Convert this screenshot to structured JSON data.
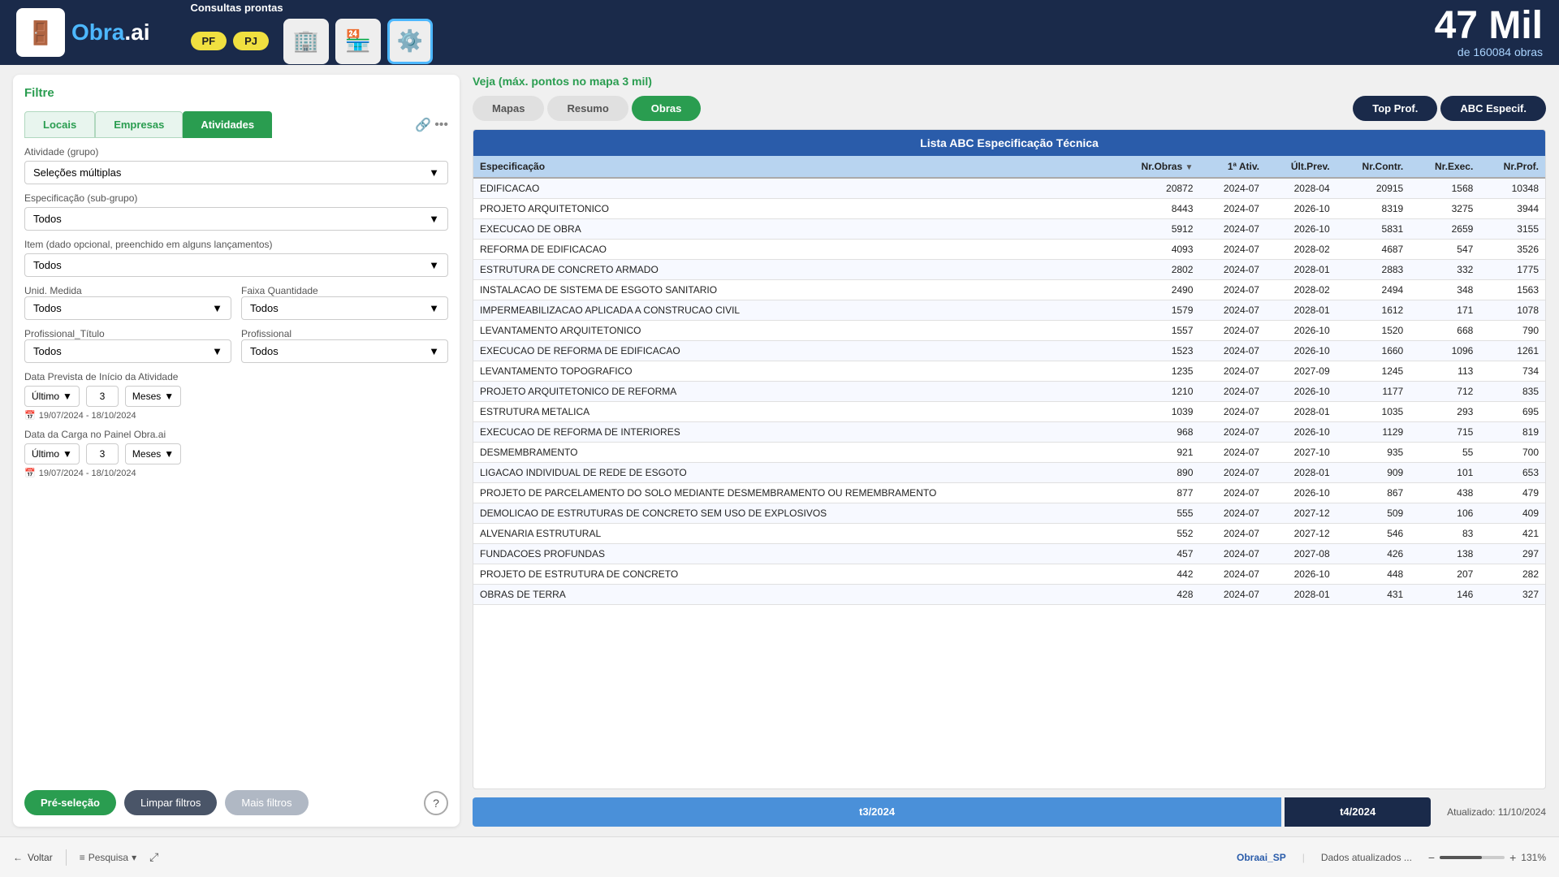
{
  "header": {
    "logo_text": "Obra.ai",
    "consultas_label": "Consultas prontas",
    "btn_pf": "PF",
    "btn_pj": "PJ",
    "big_number": "47 Mil",
    "sub_text": "de 160084 obras"
  },
  "filter": {
    "title": "Filtre",
    "tabs": [
      "Locais",
      "Empresas",
      "Atividades"
    ],
    "active_tab": 2,
    "atividade_grupo_label": "Atividade (grupo)",
    "atividade_grupo_value": "Seleções múltiplas",
    "especificacao_label": "Especificação (sub-grupo)",
    "especificacao_value": "Todos",
    "item_label": "Item (dado opcional, preenchido em alguns lançamentos)",
    "item_value": "Todos",
    "unid_medida_label": "Unid. Medida",
    "unid_medida_value": "Todos",
    "faixa_qtd_label": "Faixa Quantidade",
    "faixa_qtd_value": "Todos",
    "prof_titulo_label": "Profissional_Título",
    "prof_titulo_value": "Todos",
    "profissional_label": "Profissional",
    "profissional_value": "Todos",
    "data_prevista_label": "Data Prevista de Início da Atividade",
    "dp_period_type": "Último",
    "dp_number": "3",
    "dp_unit": "Meses",
    "dp_range": "19/07/2024 - 18/10/2024",
    "data_carga_label": "Data da Carga no Painel Obra.ai",
    "dc_period_type": "Último",
    "dc_number": "3",
    "dc_unit": "Meses",
    "dc_range": "19/07/2024 - 18/10/2024",
    "btn_preselecao": "Pré-seleção",
    "btn_limpar": "Limpar filtros",
    "btn_mais_filtros": "Mais filtros"
  },
  "right": {
    "header_label": "Veja (máx. pontos no mapa 3 mil)",
    "tabs": [
      "Mapas",
      "Resumo",
      "Obras"
    ],
    "active_tab": 2,
    "btn_top_prof": "Top Prof.",
    "btn_abc": "ABC Especif.",
    "table_title": "Lista ABC Especificação Técnica",
    "columns": [
      "Especificação",
      "Nr.Obras",
      "1ª Ativ.",
      "Últ.Prev.",
      "Nr.Contr.",
      "Nr.Exec.",
      "Nr.Prof."
    ],
    "rows": [
      {
        "especificacao": "EDIFICACAO",
        "nr_obras": "20872",
        "prim_ativ": "2024-07",
        "ult_prev": "2028-04",
        "nr_contr": "20915",
        "nr_exec": "1568",
        "nr_prof": "10348"
      },
      {
        "especificacao": "PROJETO ARQUITETONICO",
        "nr_obras": "8443",
        "prim_ativ": "2024-07",
        "ult_prev": "2026-10",
        "nr_contr": "8319",
        "nr_exec": "3275",
        "nr_prof": "3944"
      },
      {
        "especificacao": "EXECUCAO DE OBRA",
        "nr_obras": "5912",
        "prim_ativ": "2024-07",
        "ult_prev": "2026-10",
        "nr_contr": "5831",
        "nr_exec": "2659",
        "nr_prof": "3155"
      },
      {
        "especificacao": "REFORMA DE EDIFICACAO",
        "nr_obras": "4093",
        "prim_ativ": "2024-07",
        "ult_prev": "2028-02",
        "nr_contr": "4687",
        "nr_exec": "547",
        "nr_prof": "3526"
      },
      {
        "especificacao": "ESTRUTURA DE CONCRETO ARMADO",
        "nr_obras": "2802",
        "prim_ativ": "2024-07",
        "ult_prev": "2028-01",
        "nr_contr": "2883",
        "nr_exec": "332",
        "nr_prof": "1775"
      },
      {
        "especificacao": "INSTALACAO DE SISTEMA DE ESGOTO SANITARIO",
        "nr_obras": "2490",
        "prim_ativ": "2024-07",
        "ult_prev": "2028-02",
        "nr_contr": "2494",
        "nr_exec": "348",
        "nr_prof": "1563"
      },
      {
        "especificacao": "IMPERMEABILIZACAO APLICADA A CONSTRUCAO CIVIL",
        "nr_obras": "1579",
        "prim_ativ": "2024-07",
        "ult_prev": "2028-01",
        "nr_contr": "1612",
        "nr_exec": "171",
        "nr_prof": "1078"
      },
      {
        "especificacao": "LEVANTAMENTO ARQUITETONICO",
        "nr_obras": "1557",
        "prim_ativ": "2024-07",
        "ult_prev": "2026-10",
        "nr_contr": "1520",
        "nr_exec": "668",
        "nr_prof": "790"
      },
      {
        "especificacao": "EXECUCAO DE REFORMA DE EDIFICACAO",
        "nr_obras": "1523",
        "prim_ativ": "2024-07",
        "ult_prev": "2026-10",
        "nr_contr": "1660",
        "nr_exec": "1096",
        "nr_prof": "1261"
      },
      {
        "especificacao": "LEVANTAMENTO TOPOGRAFICO",
        "nr_obras": "1235",
        "prim_ativ": "2024-07",
        "ult_prev": "2027-09",
        "nr_contr": "1245",
        "nr_exec": "113",
        "nr_prof": "734"
      },
      {
        "especificacao": "PROJETO ARQUITETONICO DE REFORMA",
        "nr_obras": "1210",
        "prim_ativ": "2024-07",
        "ult_prev": "2026-10",
        "nr_contr": "1177",
        "nr_exec": "712",
        "nr_prof": "835"
      },
      {
        "especificacao": "ESTRUTURA METALICA",
        "nr_obras": "1039",
        "prim_ativ": "2024-07",
        "ult_prev": "2028-01",
        "nr_contr": "1035",
        "nr_exec": "293",
        "nr_prof": "695"
      },
      {
        "especificacao": "EXECUCAO DE REFORMA DE INTERIORES",
        "nr_obras": "968",
        "prim_ativ": "2024-07",
        "ult_prev": "2026-10",
        "nr_contr": "1129",
        "nr_exec": "715",
        "nr_prof": "819"
      },
      {
        "especificacao": "DESMEMBRAMENTO",
        "nr_obras": "921",
        "prim_ativ": "2024-07",
        "ult_prev": "2027-10",
        "nr_contr": "935",
        "nr_exec": "55",
        "nr_prof": "700"
      },
      {
        "especificacao": "LIGACAO INDIVIDUAL DE REDE DE ESGOTO",
        "nr_obras": "890",
        "prim_ativ": "2024-07",
        "ult_prev": "2028-01",
        "nr_contr": "909",
        "nr_exec": "101",
        "nr_prof": "653"
      },
      {
        "especificacao": "PROJETO DE PARCELAMENTO DO SOLO MEDIANTE DESMEMBRAMENTO OU REMEMBRAMENTO",
        "nr_obras": "877",
        "prim_ativ": "2024-07",
        "ult_prev": "2026-10",
        "nr_contr": "867",
        "nr_exec": "438",
        "nr_prof": "479"
      },
      {
        "especificacao": "DEMOLICAO DE ESTRUTURAS DE CONCRETO SEM USO DE EXPLOSIVOS",
        "nr_obras": "555",
        "prim_ativ": "2024-07",
        "ult_prev": "2027-12",
        "nr_contr": "509",
        "nr_exec": "106",
        "nr_prof": "409"
      },
      {
        "especificacao": "ALVENARIA ESTRUTURAL",
        "nr_obras": "552",
        "prim_ativ": "2024-07",
        "ult_prev": "2027-12",
        "nr_contr": "546",
        "nr_exec": "83",
        "nr_prof": "421"
      },
      {
        "especificacao": "FUNDACOES PROFUNDAS",
        "nr_obras": "457",
        "prim_ativ": "2024-07",
        "ult_prev": "2027-08",
        "nr_contr": "426",
        "nr_exec": "138",
        "nr_prof": "297"
      },
      {
        "especificacao": "PROJETO DE ESTRUTURA DE CONCRETO",
        "nr_obras": "442",
        "prim_ativ": "2024-07",
        "ult_prev": "2026-10",
        "nr_contr": "448",
        "nr_exec": "207",
        "nr_prof": "282"
      },
      {
        "especificacao": "OBRAS DE TERRA",
        "nr_obras": "428",
        "prim_ativ": "2024-07",
        "ult_prev": "2028-01",
        "nr_contr": "431",
        "nr_exec": "146",
        "nr_prof": "327"
      }
    ],
    "timeline_q3": "t3/2024",
    "timeline_q4": "t4/2024",
    "updated_text": "Atualizado: 11/10/2024"
  },
  "footer": {
    "back_label": "Voltar",
    "pesquisa_label": "Pesquisa",
    "location_label": "Obraai_SP",
    "dados_label": "Dados atualizados ...",
    "zoom_pct": "131%"
  }
}
